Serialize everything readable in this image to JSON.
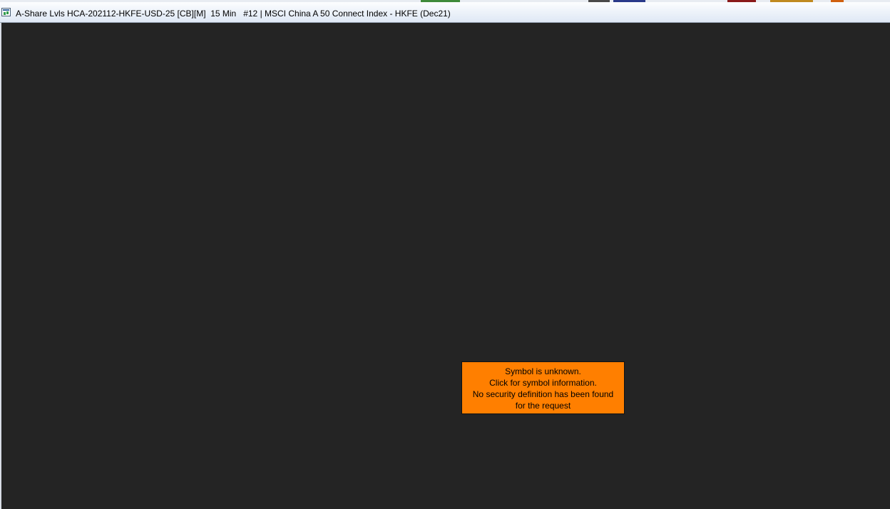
{
  "window": {
    "title": "A-Share Lvls HCA-202112-HKFE-USD-25 [CB][M]  15 Min   #12 | MSCI China A 50 Connect Index - HKFE (Dec21)"
  },
  "icons": {
    "app": "chart-window-icon"
  },
  "colors": {
    "chart_background": "#242424",
    "alert_background": "#ff7f00",
    "alert_text": "#000000"
  },
  "alert": {
    "line1": "Symbol is unknown.",
    "line2": "Click for symbol information.",
    "line3": "No security definition has been found",
    "line4": "for the request"
  }
}
